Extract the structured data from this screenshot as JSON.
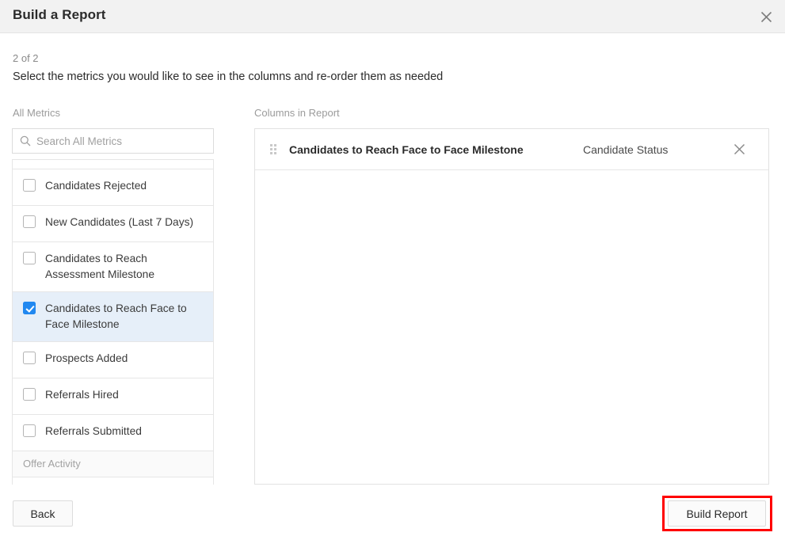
{
  "header": {
    "title": "Build a Report",
    "close_icon": "close-icon"
  },
  "step": {
    "counter": "2 of 2",
    "description": "Select the metrics you would like to see in the columns and re-order them as needed"
  },
  "left_panel": {
    "label": "All Metrics",
    "search": {
      "placeholder": "Search All Metrics",
      "value": "",
      "icon": "search-icon"
    },
    "items": [
      {
        "label": "Candidates Rejected",
        "checked": false,
        "type": "metric"
      },
      {
        "label": "New Candidates (Last 7 Days)",
        "checked": false,
        "type": "metric"
      },
      {
        "label": "Candidates to Reach Assessment Milestone",
        "checked": false,
        "type": "metric"
      },
      {
        "label": "Candidates to Reach Face to Face Milestone",
        "checked": true,
        "type": "metric"
      },
      {
        "label": "Prospects Added",
        "checked": false,
        "type": "metric"
      },
      {
        "label": "Referrals Hired",
        "checked": false,
        "type": "metric"
      },
      {
        "label": "Referrals Submitted",
        "checked": false,
        "type": "metric"
      },
      {
        "label": "Offer Activity",
        "checked": false,
        "type": "group-header"
      }
    ]
  },
  "right_panel": {
    "label": "Columns in Report",
    "columns": [
      {
        "name": "Candidates to Reach Face to Face Milestone",
        "meta": "Candidate Status",
        "drag_icon": "drag-handle-icon",
        "remove_icon": "close-icon"
      }
    ]
  },
  "footer": {
    "back_label": "Back",
    "build_label": "Build Report"
  },
  "colors": {
    "header_bg": "#f2f2f2",
    "selected_row_bg": "#e6eff9",
    "checkbox_accent": "#2188f0",
    "highlight_border": "#ff0000",
    "border": "#e6e6e6",
    "muted_text": "#9b9b9b"
  }
}
